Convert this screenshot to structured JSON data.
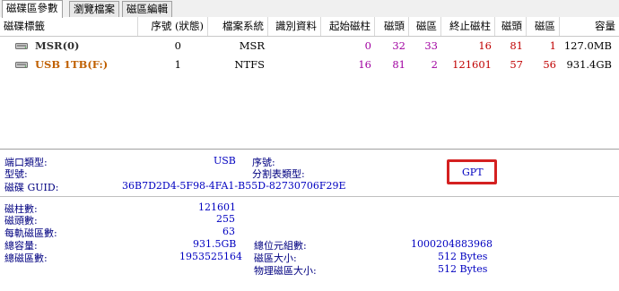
{
  "tabs": [
    "磁碟區參數",
    "瀏覽檔案",
    "磁區編輯"
  ],
  "table": {
    "headers": [
      "磁碟標籤",
      "序號 (狀態)",
      "檔案系統",
      "識別資料",
      "起始磁柱",
      "磁頭",
      "磁區",
      "終止磁柱",
      "磁頭",
      "磁區",
      "容量"
    ],
    "rows": [
      {
        "label": "MSR(0)",
        "serial": "0",
        "fs": "MSR",
        "ident": "",
        "start_cyl": "0",
        "start_head": "32",
        "start_sec": "33",
        "end_cyl": "16",
        "end_head": "81",
        "end_sec": "1",
        "capacity": "127.0MB"
      },
      {
        "label": "USB 1TB(F:)",
        "serial": "1",
        "fs": "NTFS",
        "ident": "",
        "start_cyl": "16",
        "start_head": "81",
        "start_sec": "2",
        "end_cyl": "121601",
        "end_head": "57",
        "end_sec": "56",
        "capacity": "931.4GB"
      }
    ]
  },
  "info": {
    "port_type_label": "端口類型:",
    "port_type_value": "USB",
    "serial_label": "序號:",
    "model_label": "型號:",
    "partition_table_label": "分割表類型:",
    "partition_table_value": "GPT",
    "guid_label": "磁碟 GUID:",
    "guid_value": "36B7D2D4-5F98-4FA1-B55D-82730706F29E",
    "cylinders_label": "磁柱數:",
    "cylinders_value": "121601",
    "heads_label": "磁頭數:",
    "heads_value": "255",
    "sectors_per_track_label": "每軌磁區數:",
    "sectors_per_track_value": "63",
    "capacity_label": "總容量:",
    "capacity_value": "931.5GB",
    "total_bytes_label": "總位元組數:",
    "total_bytes_value": "1000204883968",
    "total_sectors_label": "總磁區數:",
    "total_sectors_value": "1953525164",
    "sector_size_label": "磁區大小:",
    "sector_size_value": "512 Bytes",
    "physical_sector_label": "物理磁區大小:",
    "physical_sector_value": "512 Bytes"
  },
  "colors": {
    "highlight": "#d42020",
    "label": "#000080",
    "value": "#0000c0"
  }
}
